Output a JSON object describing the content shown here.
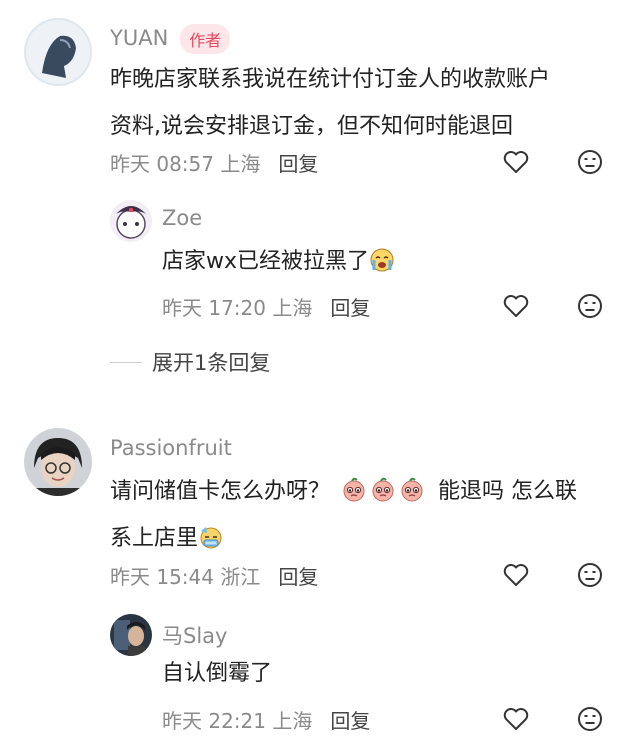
{
  "comments": [
    {
      "username": "YUAN",
      "badge": "作者",
      "text_line1": "昨晚店家联系我说在统计付订金人的收款账户",
      "text_line2": "资料,说会安排退订金，但不知何时能退回",
      "meta": "昨天 08:57 上海",
      "reply_label": "回复",
      "replies": [
        {
          "username": "Zoe",
          "text": "店家wx已经被拉黑了",
          "emoji": "crying-face",
          "meta": "昨天 17:20 上海",
          "reply_label": "回复"
        }
      ],
      "expand_label": "展开1条回复"
    },
    {
      "username": "Passionfruit",
      "text_part1": "请问储值卡怎么办呀？",
      "emojis_middle": [
        "pleading-peach",
        "pleading-peach",
        "pleading-peach"
      ],
      "text_part2": "能退吗 怎么联",
      "text_line2": "系上店里",
      "emoji_end": "sweating-face",
      "meta": "昨天 15:44 浙江",
      "reply_label": "回复",
      "replies": [
        {
          "username": "马Slay",
          "text": "自认倒霉了",
          "meta": "昨天 22:21 上海",
          "reply_label": "回复"
        }
      ]
    }
  ],
  "icons": {
    "like": "heart-outline-icon",
    "dislike": "meh-face-icon"
  }
}
